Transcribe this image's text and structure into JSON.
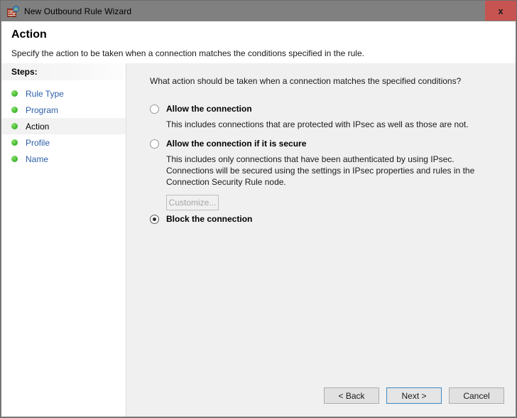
{
  "window": {
    "title": "New Outbound Rule Wizard",
    "icon": "firewall-globe-icon",
    "close_label": "x",
    "titlebar_color": "#808080",
    "close_color": "#c75450"
  },
  "header": {
    "title": "Action",
    "subtitle": "Specify the action to be taken when a connection matches the conditions specified in the rule."
  },
  "sidebar": {
    "heading": "Steps:",
    "items": [
      {
        "label": "Rule Type",
        "current": false
      },
      {
        "label": "Program",
        "current": false
      },
      {
        "label": "Action",
        "current": true
      },
      {
        "label": "Profile",
        "current": false
      },
      {
        "label": "Name",
        "current": false
      }
    ],
    "bullet_color": "#4bbf39",
    "link_color": "#2d5fa8"
  },
  "main": {
    "question": "What action should be taken when a connection matches the specified conditions?",
    "options": [
      {
        "label": "Allow the connection",
        "description": "This includes connections that are protected with IPsec as well as those are not.",
        "selected": false
      },
      {
        "label": "Allow the connection if it is secure",
        "description": "This includes only connections that have been authenticated by using IPsec.  Connections will be secured using the settings in IPsec properties and rules in the Connection Security Rule node.",
        "selected": false,
        "sub_button": {
          "label": "Customize...",
          "disabled": true
        }
      },
      {
        "label": "Block the connection",
        "description": "",
        "selected": true
      }
    ]
  },
  "footer": {
    "buttons": [
      {
        "label": "< Back",
        "default": false
      },
      {
        "label": "Next >",
        "default": true
      },
      {
        "label": "Cancel",
        "default": false
      }
    ]
  }
}
